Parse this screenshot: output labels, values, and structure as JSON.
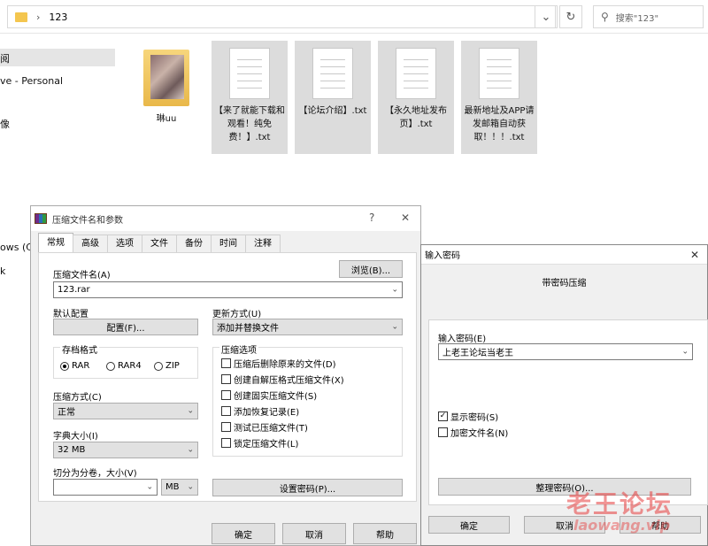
{
  "explorer": {
    "breadcrumb_separator": "›",
    "path": "123",
    "search_placeholder": "搜索\"123\"",
    "nav": {
      "item_1": "阅",
      "item_2": "ve - Personal",
      "item_3": "像",
      "item_4": "ows (C:)",
      "item_5": "k"
    },
    "files": [
      {
        "name": "琳uu",
        "type": "folder"
      },
      {
        "name": "【来了就能下载和观看！纯免费！】.txt",
        "type": "txt"
      },
      {
        "name": "【论坛介绍】.txt",
        "type": "txt"
      },
      {
        "name": "【永久地址发布页】.txt",
        "type": "txt"
      },
      {
        "name": "最新地址及APP请发邮箱自动获取！！！.txt",
        "type": "txt"
      }
    ]
  },
  "archive_dialog": {
    "title": "压缩文件名和参数",
    "help_glyph": "?",
    "close_glyph": "✕",
    "tabs": [
      "常规",
      "高级",
      "选项",
      "文件",
      "备份",
      "时间",
      "注释"
    ],
    "archive_name_label": "压缩文件名(A)",
    "browse_button": "浏览(B)...",
    "archive_name_value": "123.rar",
    "default_profile_label": "默认配置",
    "profiles_button": "配置(F)...",
    "update_mode_label": "更新方式(U)",
    "update_mode_value": "添加并替换文件",
    "format_group_label": "存档格式",
    "formats": [
      {
        "label": "RAR",
        "selected": true
      },
      {
        "label": "RAR4",
        "selected": false
      },
      {
        "label": "ZIP",
        "selected": false
      }
    ],
    "method_label": "压缩方式(C)",
    "method_value": "正常",
    "dict_label": "字典大小(I)",
    "dict_value": "32 MB",
    "split_label": "切分为分卷，大小(V)",
    "split_value": "",
    "split_unit": "MB",
    "options_group_label": "压缩选项",
    "options": [
      {
        "label": "压缩后删除原来的文件(D)",
        "checked": false
      },
      {
        "label": "创建自解压格式压缩文件(X)",
        "checked": false
      },
      {
        "label": "创建固实压缩文件(S)",
        "checked": false
      },
      {
        "label": "添加恢复记录(E)",
        "checked": false
      },
      {
        "label": "测试已压缩文件(T)",
        "checked": false
      },
      {
        "label": "锁定压缩文件(L)",
        "checked": false
      }
    ],
    "set_password_button": "设置密码(P)...",
    "ok_button": "确定",
    "cancel_button": "取消",
    "help_button": "帮助"
  },
  "password_dialog": {
    "title": "输入密码",
    "close_glyph": "✕",
    "subtitle": "带密码压缩",
    "enter_password_label": "输入密码(E)",
    "password_value": "上老王论坛当老王",
    "show_password_label": "显示密码(S)",
    "show_password_checked": true,
    "encrypt_names_label": "加密文件名(N)",
    "encrypt_names_checked": false,
    "organize_button": "整理密码(O)...",
    "ok_button": "确定",
    "cancel_button": "取消",
    "help_button": "帮助"
  },
  "watermark": {
    "line1": "老王论坛",
    "line2": "laowang.vip"
  },
  "colors": {
    "dialog_bg": "#f0f0f0",
    "button_bg": "#e1e1e1",
    "selected_tile": "#dcdcdc",
    "folder": "#f4c64f",
    "watermark": "#e63c3c"
  }
}
